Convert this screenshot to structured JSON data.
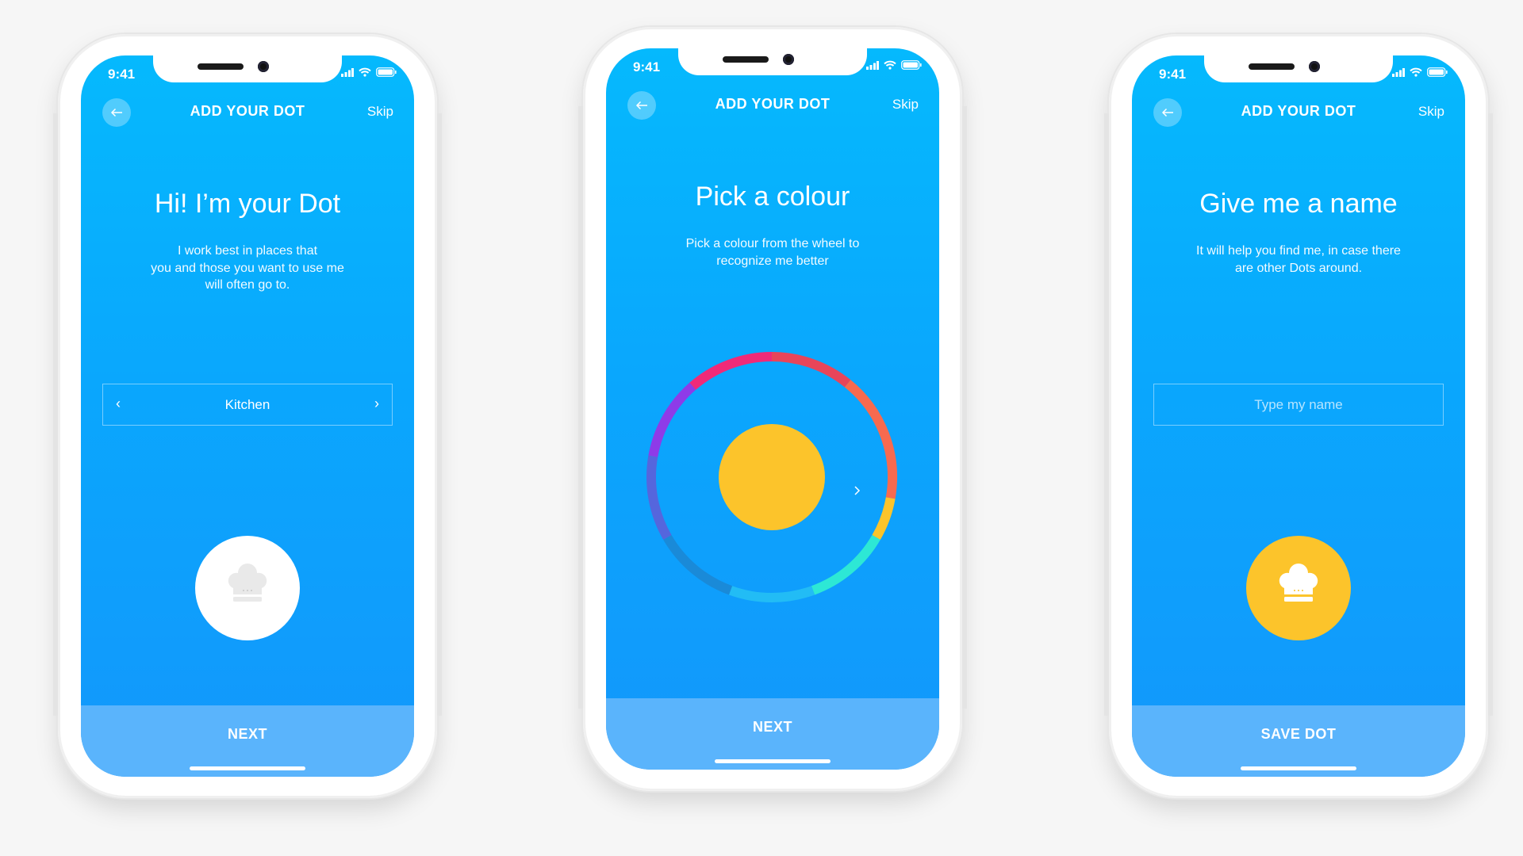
{
  "status_bar": {
    "time": "9:41"
  },
  "header": {
    "title": "ADD YOUR DOT",
    "skip_label": "Skip"
  },
  "screens": [
    {
      "headline": "Hi! I’m your Dot",
      "description": [
        "I work best in places that",
        "you and those you want to use me",
        "will often go to."
      ],
      "selector": {
        "value": "Kitchen",
        "prev_icon": "chevron-left-icon",
        "next_icon": "chevron-right-icon"
      },
      "avatar_icon": "chef-hat-icon",
      "primary_button": "NEXT"
    },
    {
      "headline": "Pick a colour",
      "description": [
        "Pick a colour from the wheel to",
        "recognize me better"
      ],
      "selected_colour": "#fcc42b",
      "wheel_colours": [
        "#e8455a",
        "#f76a4f",
        "#fcc42b",
        "#2de8d5",
        "#22bcf5",
        "#1a8ad8",
        "#5566dd",
        "#8e3be8",
        "#f02a78"
      ],
      "primary_button": "NEXT"
    },
    {
      "headline": "Give me a name",
      "description": [
        "It will help you find me, in case there",
        "are other Dots around."
      ],
      "name_input": {
        "value": "",
        "placeholder": "Type my name"
      },
      "avatar_icon": "chef-hat-icon",
      "avatar_colour": "#fcc42b",
      "primary_button": "SAVE DOT"
    }
  ]
}
